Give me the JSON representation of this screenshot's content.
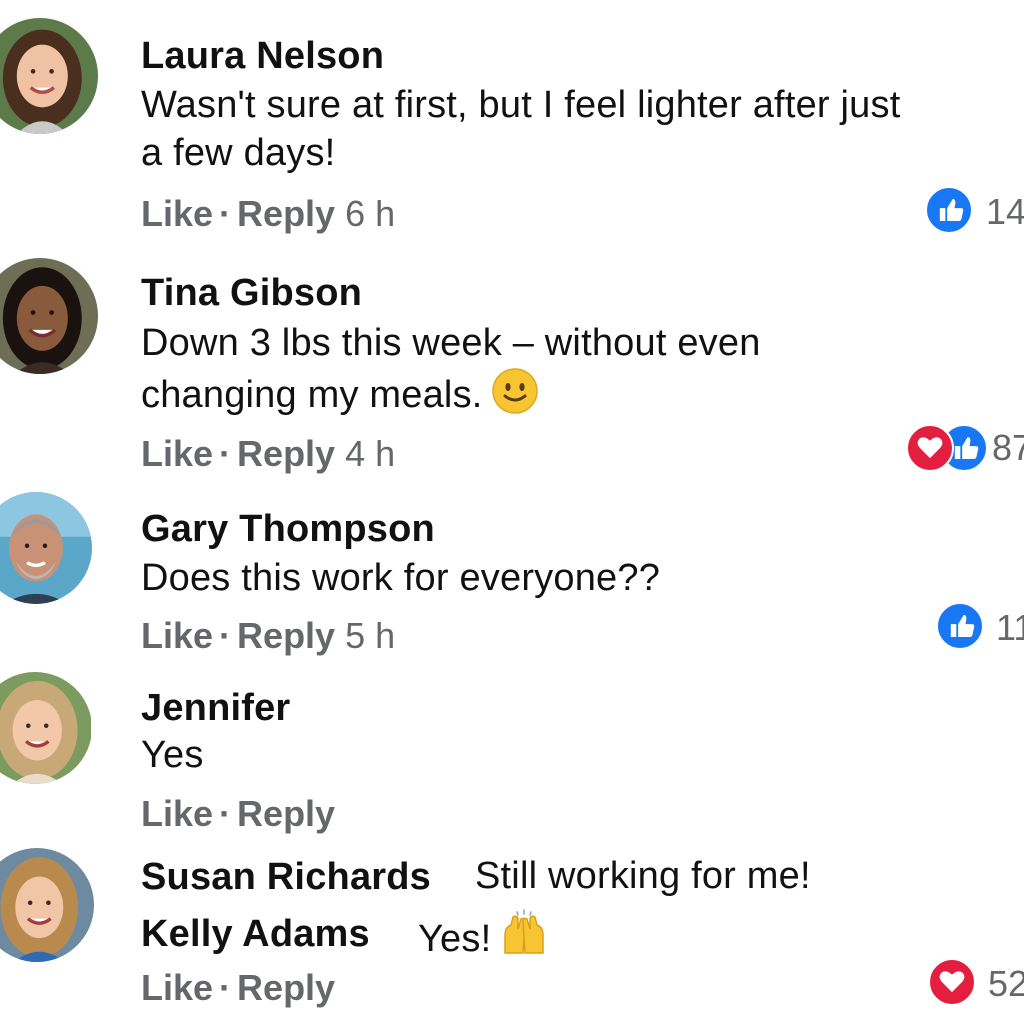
{
  "colors": {
    "like_blue": "#1877f2",
    "love_red": "#e41e3f",
    "meta_gray": "#65676b"
  },
  "actions": {
    "like_label": "Like",
    "reply_label": "Reply",
    "separator": "·"
  },
  "comments": [
    {
      "name": "Laura Nelson",
      "text_line1": "Wasn't sure at first, but I feel lighter after just",
      "text_line2": "a few days!",
      "time": "6 h",
      "reaction_icons": [
        "like-icon"
      ],
      "reaction_count": "14"
    },
    {
      "name": "Tina Gibson",
      "text_line1": "Down 3 lbs this week – without even",
      "text_line2": "changing my meals.",
      "emoji": "slightly-smiling-face-emoji",
      "time": "4 h",
      "reaction_icons": [
        "love-icon",
        "like-icon"
      ],
      "reaction_count": "87"
    },
    {
      "name": "Gary Thompson",
      "text_line1": "Does this work for everyone??",
      "time": "5 h",
      "reaction_icons": [
        "like-icon"
      ],
      "reaction_count": "11"
    },
    {
      "name": "Jennifer",
      "text_line1": "Yes"
    }
  ],
  "replies": [
    {
      "name": "Susan Richards",
      "text": "Still working for me!"
    },
    {
      "name": "Kelly Adams",
      "text": "Yes!",
      "emoji": "raising-hands-emoji"
    }
  ],
  "last_reactions": {
    "reaction_icons": [
      "love-icon"
    ],
    "reaction_count": "52"
  }
}
